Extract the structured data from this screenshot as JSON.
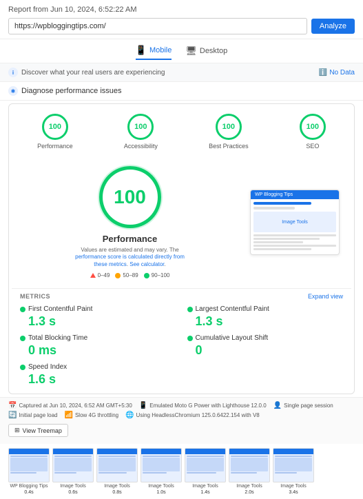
{
  "header": {
    "title": "Report from Jun 10, 2024, 6:52:22 AM",
    "url": "https://wpbloggingtips.com/",
    "analyze_label": "Analyze"
  },
  "tabs": [
    {
      "id": "mobile",
      "label": "Mobile",
      "active": true,
      "icon": "📱"
    },
    {
      "id": "desktop",
      "label": "Desktop",
      "active": false,
      "icon": "🖥"
    }
  ],
  "real_users_bar": {
    "text": "Discover what your real users are experiencing",
    "no_data_label": "No Data"
  },
  "diagnose_bar": {
    "text": "Diagnose performance issues"
  },
  "scores": [
    {
      "label": "Performance",
      "value": "100"
    },
    {
      "label": "Accessibility",
      "value": "100"
    },
    {
      "label": "Best Practices",
      "value": "100"
    },
    {
      "label": "SEO",
      "value": "100"
    }
  ],
  "main_score": {
    "value": "100",
    "title": "Performance",
    "note": "Values are estimated and may vary. The performance score is calculated directly from these metrics. See calculator.",
    "legend": [
      {
        "color": "red",
        "range": "0–49"
      },
      {
        "color": "orange",
        "range": "50–89"
      },
      {
        "color": "green",
        "range": "90–100"
      }
    ]
  },
  "preview": {
    "site_name": "WP Blogging Tips",
    "label1": "Image Tools"
  },
  "metrics": {
    "section_label": "METRICS",
    "expand_label": "Expand view",
    "items": [
      {
        "name": "First Contentful Paint",
        "value": "1.3 s"
      },
      {
        "name": "Largest Contentful Paint",
        "value": "1.3 s"
      },
      {
        "name": "Total Blocking Time",
        "value": "0 ms"
      },
      {
        "name": "Cumulative Layout Shift",
        "value": "0"
      },
      {
        "name": "Speed Index",
        "value": "1.6 s"
      }
    ]
  },
  "footer": {
    "items": [
      {
        "icon": "📅",
        "text": "Captured at Jun 10, 2024, 6:52 AM GMT+5:30"
      },
      {
        "icon": "📱",
        "text": "Emulated Moto G Power with Lighthouse 12.0.0"
      },
      {
        "icon": "👤",
        "text": "Single page session"
      },
      {
        "icon": "🔄",
        "text": "Initial page load"
      },
      {
        "icon": "📶",
        "text": "Slow 4G throttling"
      },
      {
        "icon": "🌐",
        "text": "Using HeadlessChromium 125.0.6422.154 with V8"
      }
    ],
    "treemap_label": "View Treemap"
  },
  "thumbnails": [
    {
      "time": "0.4s"
    },
    {
      "time": "0.6s"
    },
    {
      "time": "0.8s"
    },
    {
      "time": "1.0s"
    },
    {
      "time": "1.4s"
    },
    {
      "time": "2.0s"
    },
    {
      "time": "3.4s"
    }
  ]
}
